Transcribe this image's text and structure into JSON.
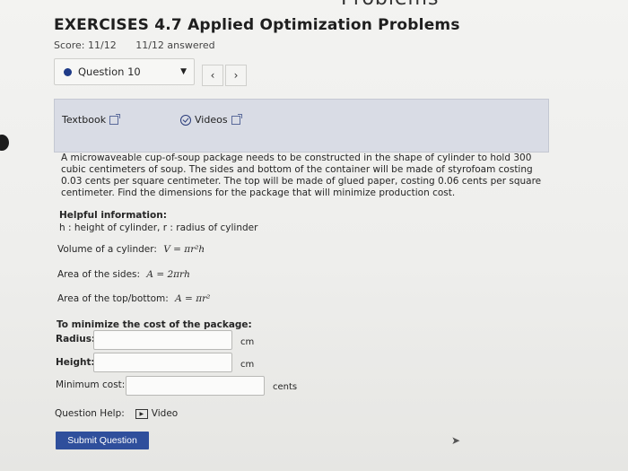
{
  "header": {
    "partial_top_text": "Problems",
    "title": "EXERCISES 4.7 Applied Optimization Problems",
    "score": "Score: 11/12",
    "answered": "11/12 answered"
  },
  "question_nav": {
    "selected_question": "Question 10",
    "prev_icon": "chevron-left",
    "next_icon": "chevron-right"
  },
  "resources": {
    "textbook_label": "Textbook",
    "videos_label": "Videos"
  },
  "problem": {
    "text": "A microwaveable cup-of-soup package needs to be constructed in the shape of cylinder to hold 300 cubic centimeters of soup. The sides and bottom of the container will be made of styrofoam costing 0.03 cents per square centimeter. The top will be made of glued paper, costing 0.06 cents per square centimeter. Find the dimensions for the package that will minimize production cost.",
    "helpful_title": "Helpful information:",
    "helpful_vars": "h : height of cylinder, r : radius of cylinder",
    "volume_label": "Volume of a cylinder:",
    "volume_formula": "V = πr²h",
    "sides_label": "Area of the sides:",
    "sides_formula": "A = 2πrh",
    "topbottom_label": "Area of the top/bottom:",
    "topbottom_formula": "A = πr²"
  },
  "answer": {
    "title": "To minimize the cost of the package:",
    "radius_label": "Radius:",
    "radius_value": "",
    "radius_unit": "cm",
    "height_label": "Height:",
    "height_value": "",
    "height_unit": "cm",
    "cost_label": "Minimum cost:",
    "cost_value": "",
    "cost_unit": "cents"
  },
  "help": {
    "label": "Question Help:",
    "video_label": "Video"
  },
  "submit_label": "Submit Question",
  "colors": {
    "accent": "#2f4f9c",
    "panel": "#d9dce5"
  }
}
